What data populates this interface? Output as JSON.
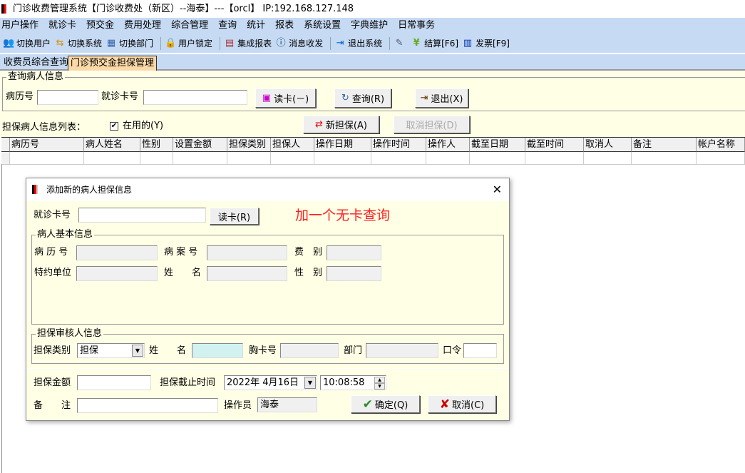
{
  "window": {
    "title": "门诊收费管理系统【门诊收费处（新区）--海泰】---【orcl】 IP:192.168.127.148"
  },
  "menu": [
    "用户操作",
    "就诊卡",
    "预交金",
    "费用处理",
    "综合管理",
    "查询",
    "统计",
    "报表",
    "系统设置",
    "字典维护",
    "日常事务"
  ],
  "toolbar": [
    {
      "label": "切换用户",
      "icon": "users-icon"
    },
    {
      "label": "切换系统",
      "icon": "switch-system-icon"
    },
    {
      "label": "切换部门",
      "icon": "department-icon"
    },
    {
      "label": "用户锁定",
      "icon": "user-lock-icon"
    },
    {
      "label": "集成报表",
      "icon": "report-icon"
    },
    {
      "label": "消息收发",
      "icon": "info-icon"
    },
    {
      "label": "退出系统",
      "icon": "exit-icon"
    },
    {
      "label": "",
      "icon": "edit-icon"
    },
    {
      "label": "结算[F6]",
      "icon": "yen-icon"
    },
    {
      "label": "发票[F9]",
      "icon": "invoice-icon"
    }
  ],
  "tabs": [
    {
      "label": "收费员综合查询",
      "active": false
    },
    {
      "label": "门诊预交金担保管理",
      "active": true
    }
  ],
  "query": {
    "group_title": "查询病人信息",
    "record_no_label": "病历号",
    "record_no_value": "",
    "card_no_label": "就诊卡号",
    "card_no_value": "",
    "read_card": "读卡(－)",
    "search": "查询(R)",
    "exit": "退出(X)"
  },
  "list": {
    "title": "担保病人信息列表：",
    "in_use_label": "在用的(Y)",
    "in_use_checked": true,
    "new_guarantee": "新担保(A)",
    "cancel_guarantee": "取消担保(D)",
    "columns": [
      "病历号",
      "病人姓名",
      "性别",
      "设置金额",
      "担保类别",
      "担保人",
      "操作日期",
      "操作时间",
      "操作人",
      "截至日期",
      "截至时间",
      "取消人",
      "备注",
      "帐户名称"
    ]
  },
  "dialog": {
    "title": "添加新的病人担保信息",
    "card_no_label": "就诊卡号",
    "card_no_value": "",
    "read_card": "读卡(R)",
    "annotation": "加一个无卡查询",
    "annotation_color": "#ff2020",
    "patient_group": "病人基本信息",
    "patient_fields": [
      {
        "label": "病 历 号",
        "value": ""
      },
      {
        "label": "病 案 号",
        "value": ""
      },
      {
        "label": "费　别",
        "value": ""
      },
      {
        "label": "特约单位",
        "value": ""
      },
      {
        "label": "姓　　名",
        "value": ""
      },
      {
        "label": "性　别",
        "value": ""
      }
    ],
    "auditor_group": "担保审核人信息",
    "guarantee_type_label": "担保类别",
    "guarantee_type_value": "担保",
    "name_label": "姓　　名",
    "name_value": "",
    "badge_label": "胸卡号",
    "badge_value": "",
    "dept_label": "部门",
    "dept_value": "",
    "password_label": "口令",
    "password_value": "",
    "amount_label": "担保金额",
    "amount_value": "",
    "deadline_label": "担保截止时间",
    "deadline_date": "2022年  4月16日",
    "deadline_time": "10:08:58",
    "remark_label": "备　　注",
    "remark_value": "",
    "operator_label": "操作员",
    "operator_value": "海泰",
    "ok": "确定(Q)",
    "cancel": "取消(C)"
  }
}
